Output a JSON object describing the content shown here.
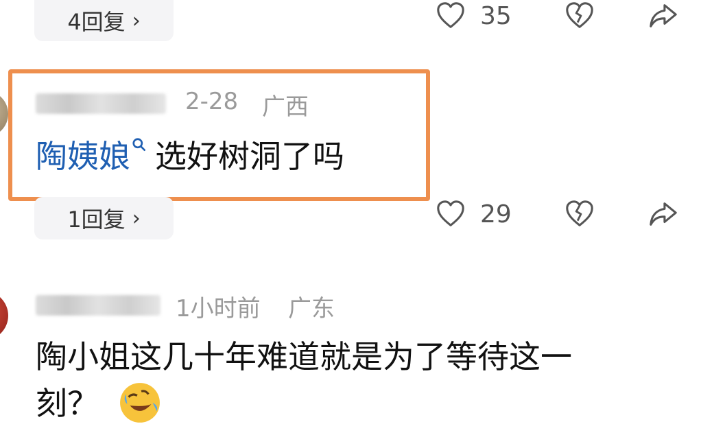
{
  "top_row": {
    "reply_label": "4回复",
    "like_count": "35"
  },
  "comment_1": {
    "date": "2-28",
    "location": "广西",
    "mention": "陶姨娘",
    "text": "选好树洞了吗",
    "reply_label": "1回复",
    "like_count": "29"
  },
  "comment_2": {
    "time": "1小时前",
    "location": "广东",
    "text_line1": "陶小姐这几十年难道就是为了等待这一",
    "text_line2": "刻？"
  },
  "icons": {
    "like": "heart-icon",
    "dislike": "broken-heart-icon",
    "share": "share-arrow-icon",
    "search": "search-icon",
    "chevron": "chevron-right-icon",
    "emoji": "rolling-laughing-emoji"
  },
  "colors": {
    "highlight": "#ee8f4e",
    "mention": "#1f5fb2",
    "meta": "#9a9a9a"
  }
}
